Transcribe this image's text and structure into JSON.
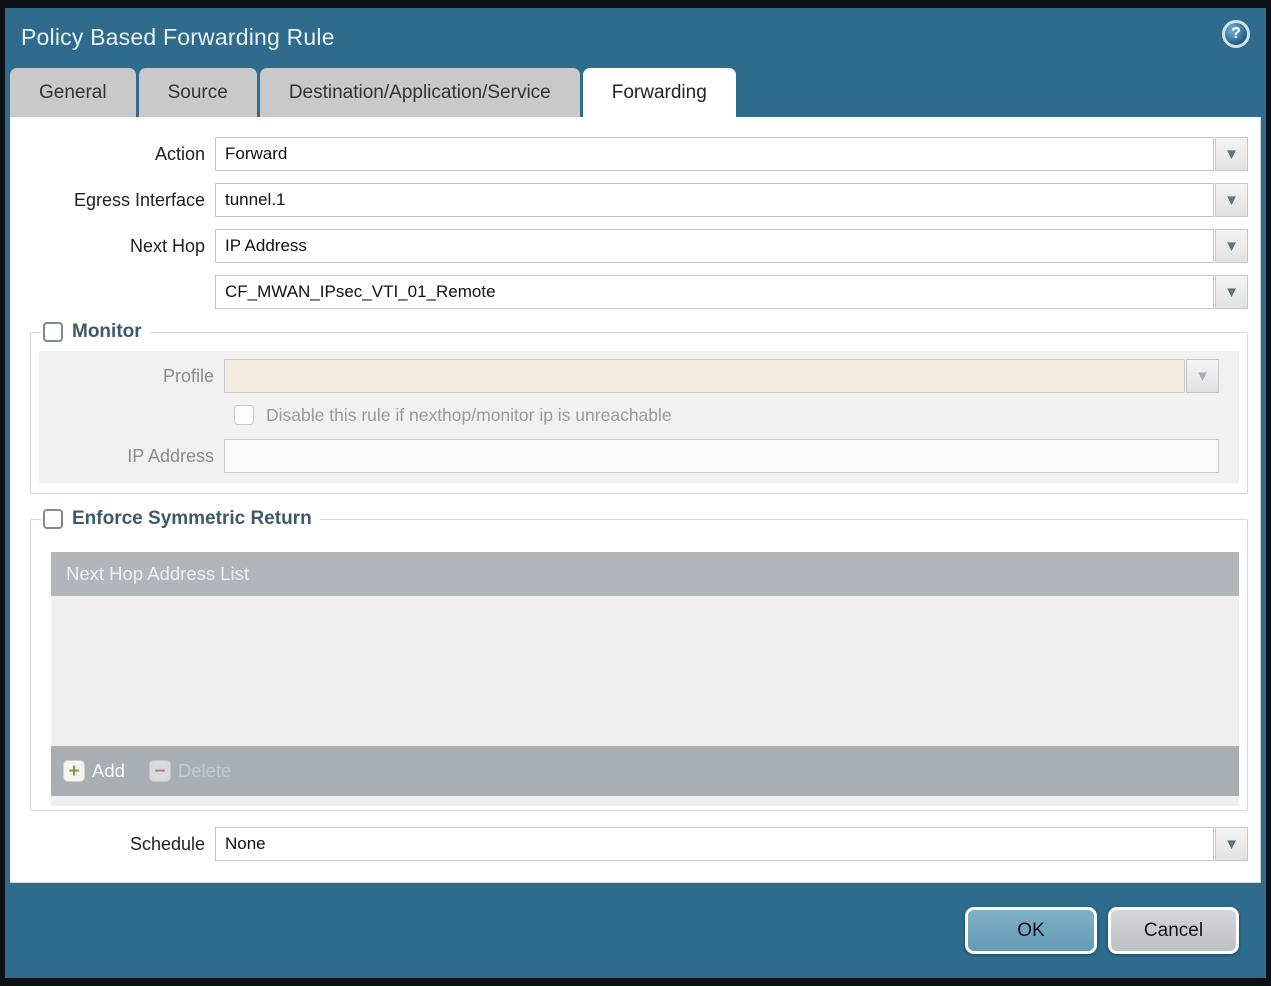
{
  "dialog": {
    "title": "Policy Based Forwarding Rule"
  },
  "icons": {
    "help": "?",
    "dropdown_arrow": "▼",
    "add_plus": "+",
    "delete_minus": "−"
  },
  "tabs": [
    {
      "label": "General",
      "active": false
    },
    {
      "label": "Source",
      "active": false
    },
    {
      "label": "Destination/Application/Service",
      "active": false
    },
    {
      "label": "Forwarding",
      "active": true
    }
  ],
  "form": {
    "action": {
      "label": "Action",
      "value": "Forward"
    },
    "egress_interface": {
      "label": "Egress Interface",
      "value": "tunnel.1"
    },
    "next_hop": {
      "label": "Next Hop",
      "value": "IP Address"
    },
    "next_hop_address": {
      "value": "CF_MWAN_IPsec_VTI_01_Remote"
    },
    "schedule": {
      "label": "Schedule",
      "value": "None"
    }
  },
  "monitor": {
    "title": "Monitor",
    "checked": false,
    "profile": {
      "label": "Profile",
      "value": ""
    },
    "disable_rule": {
      "label": "Disable this rule if nexthop/monitor ip is unreachable",
      "checked": false
    },
    "ip_address": {
      "label": "IP Address",
      "value": ""
    }
  },
  "symmetric_return": {
    "title": "Enforce Symmetric Return",
    "checked": false,
    "list_header": "Next Hop Address List",
    "rows": [],
    "add_label": "Add",
    "delete_label": "Delete",
    "delete_enabled": false
  },
  "footer": {
    "ok": "OK",
    "cancel": "Cancel"
  },
  "colors": {
    "frame": "#2e6b8c",
    "outer_border": "#0c1116",
    "tab_inactive": "#c9c9c9",
    "tab_active": "#ffffff",
    "legend_text": "#3d5a6b",
    "disabled_field_beige": "#f2ecde",
    "panel_gray": "#f1f1f1",
    "table_header": "#b2b6ba",
    "table_footer": "#a9aeb3",
    "ok_button": "#6ea3bc",
    "cancel_button": "#c9cacd",
    "add_plus": "#8b9a33",
    "delete_minus": "#c4757d"
  }
}
